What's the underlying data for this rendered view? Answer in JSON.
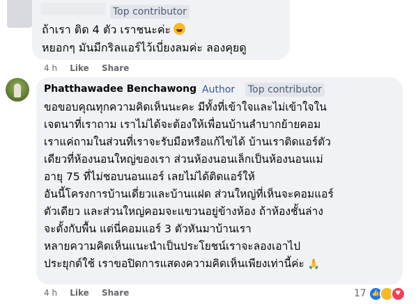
{
  "comment1": {
    "badge": "Top contributor",
    "lines": [
      "ถ้าเรา ติด 4 ตัว เราชนะค่ะ",
      "หยอกๆ มันมีกริลแอร์ไว้เบี่ยงลมค่ะ ลองคุยดู"
    ],
    "actions": {
      "time": "4 h",
      "like": "Like",
      "share": "Share"
    }
  },
  "comment2": {
    "author": "Phatthawadee Benchawong",
    "author_badge": "Author",
    "badge": "Top contributor",
    "lines": [
      "ขอขอบคุณทุกความคิดเห็นนะคะ มีทั้งที่เข้าใจและไม่เข้าใจใน",
      "เจตนาที่เราถาม เราไม่ได้จะต้องให้เพื่อนบ้านลำบากย้ายคอม",
      "เราแค่ถามในส่วนที่เราจะรับมือหรือแก้ไขได้ บ้านเราติดแอร์ตัว",
      "เดียวที่ห้องนอนใหญ่ของเรา ส่วนห้องนอนเล็กเป็นห้องนอนแม่",
      "อายุ 75 ที่ไม่ชอบนอนแอร์ เลยไม่ได้ติดแอร์ให้",
      "อันนี้โครงการบ้านเดี่ยวและบ้านแฝด ส่วนใหญ่ที่เห็นจะคอมแอร์",
      "ตัวเดียว และส่วนใหญ่คอมจะแขวนอยู่ข้างห้อง ถ้าห้องชั้นล่าง",
      "จะตั้งกับพื้น แต่นี่คอมแอร์ 3 ตัวหันมาบ้านเรา",
      "หลายความคิดเห็นแนะนำเป็นประโยชน์เราจะลองเอาไป",
      "ประยุกต์ใช้ เราขอปิดการแสดงความคิดเห็นเพียงเท่านี้ค่ะ"
    ],
    "actions": {
      "time": "4 h",
      "like": "Like",
      "share": "Share"
    },
    "reaction_count": "17"
  },
  "colors": {
    "bubble": "#f0f2f5",
    "author": "#385898",
    "meta": "#65676b"
  }
}
